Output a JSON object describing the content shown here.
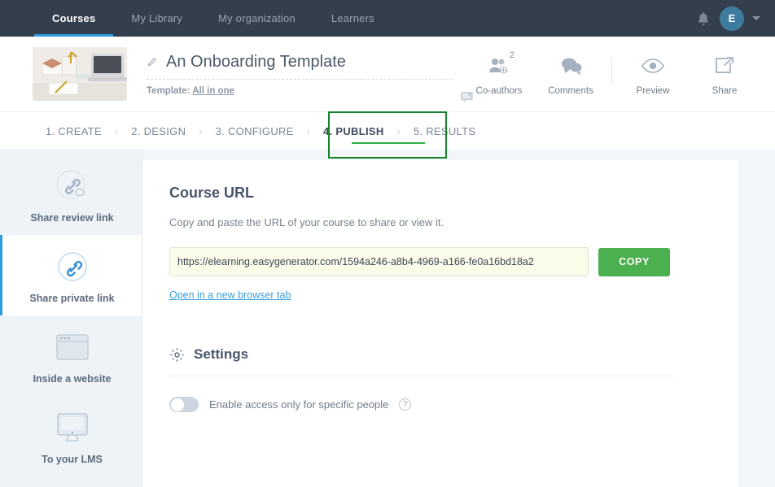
{
  "topnav": {
    "items": [
      {
        "label": "Courses",
        "active": true
      },
      {
        "label": "My Library",
        "active": false
      },
      {
        "label": "My organization",
        "active": false
      },
      {
        "label": "Learners",
        "active": false
      }
    ],
    "notifications_icon": "bell-icon",
    "avatar_initial": "E",
    "accent_color": "#2f9ae0",
    "background_color": "#343f4e"
  },
  "course_header": {
    "title": "An Onboarding Template",
    "edit_icon": "pencil-icon",
    "template_prefix": "Template:",
    "template_name": "All in one",
    "comment_icon": "comment-bubble-icon",
    "actions": [
      {
        "label": "Co-authors",
        "icon": "co-authors-icon",
        "badge": "2"
      },
      {
        "label": "Comments",
        "icon": "comments-icon",
        "badge": ""
      },
      {
        "label": "Preview",
        "icon": "eye-icon",
        "badge": ""
      },
      {
        "label": "Share",
        "icon": "share-icon",
        "badge": ""
      }
    ]
  },
  "steps": {
    "items": [
      {
        "label": "1. CREATE",
        "active": false
      },
      {
        "label": "2. DESIGN",
        "active": false
      },
      {
        "label": "3. CONFIGURE",
        "active": false
      },
      {
        "label": "4. PUBLISH",
        "active": true
      },
      {
        "label": "5. RESULTS",
        "active": false
      }
    ],
    "separator": "›",
    "highlight_color": "#14832a",
    "active_underline_color": "#2fb34a"
  },
  "sidebar": {
    "items": [
      {
        "label": "Share review link",
        "icon": "link-comment-icon",
        "active": false
      },
      {
        "label": "Share private link",
        "icon": "link-icon",
        "active": true
      },
      {
        "label": "Inside a website",
        "icon": "browser-window-icon",
        "active": false
      },
      {
        "label": "To your LMS",
        "icon": "monitor-icon",
        "active": false
      }
    ],
    "active_indicator_color": "#2f9ae0"
  },
  "main": {
    "course_url": {
      "title": "Course URL",
      "description": "Copy and paste the URL of your course to share or view it.",
      "url_value": "https://elearning.easygenerator.com/1594a246-a8b4-4969-a166-fe0a16bd18a2",
      "url_placeholder": "Course URL",
      "copy_label": "COPY",
      "copy_color": "#4caf50",
      "open_tab_link": "Open in a new browser tab"
    },
    "settings": {
      "title": "Settings",
      "icon": "gear-icon",
      "toggle": {
        "label": "Enable access only for specific people",
        "state": "off",
        "help_icon": "question-mark-icon",
        "help_glyph": "?"
      }
    }
  }
}
